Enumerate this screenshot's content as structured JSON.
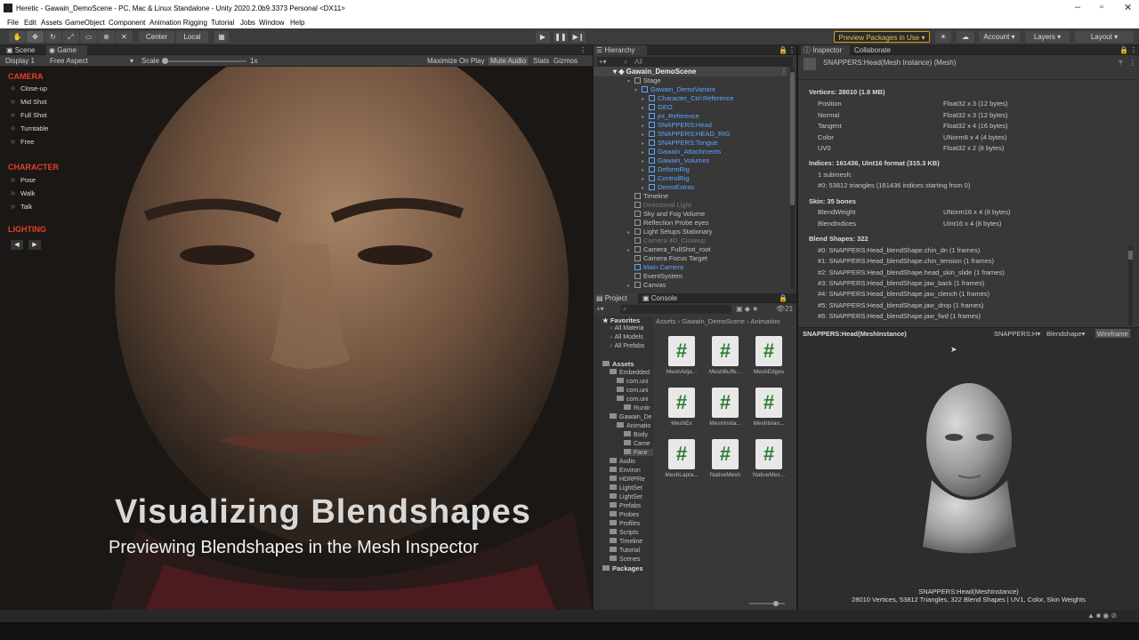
{
  "window": {
    "title": "Heretic - Gawain_DemoScene - PC, Mac & Linux Standalone - Unity 2020.2.0b9.3373 Personal <DX11>"
  },
  "menu": [
    "File",
    "Edit",
    "Assets",
    "GameObject",
    "Component",
    "Animation Rigging",
    "Tutorial",
    "Jobs",
    "Window",
    "Help"
  ],
  "toolbar": {
    "center": "Center",
    "local": "Local",
    "packages": "Preview Packages in Use",
    "account": "Account",
    "layers": "Layers",
    "layout": "Layout"
  },
  "scene_tabs": {
    "scene": "Scene",
    "game": "Game"
  },
  "game_bar": {
    "display": "Display 1",
    "aspect": "Free Aspect",
    "scale_label": "Scale",
    "scale_value": "1x",
    "maximize": "Maximize On Play",
    "mute": "Mute Audio",
    "stats": "Stats",
    "gizmos": "Gizmos"
  },
  "overlay": {
    "camera_title": "CAMERA",
    "camera_opts": [
      "Close-up",
      "Mid Shot",
      "Full Shot",
      "Turntable",
      "Free"
    ],
    "character_title": "CHARACTER",
    "character_opts": [
      "Pose",
      "Walk",
      "Talk"
    ],
    "lighting_title": "LIGHTING",
    "prev": "◀",
    "next": "▶",
    "title": "Visualizing Blendshapes",
    "subtitle": "Previewing Blendshapes in the Mesh Inspector"
  },
  "hierarchy": {
    "tab": "Hierarchy",
    "search": "All",
    "scene": "Gawain_DemoScene",
    "items": [
      {
        "label": "Stage",
        "kind": "normal"
      },
      {
        "label": "Gawain_DemoVariant",
        "kind": "blue"
      },
      {
        "label": "Character_Ctrl:Reference",
        "kind": "blue"
      },
      {
        "label": "GEO",
        "kind": "blue"
      },
      {
        "label": "jnt_Reference",
        "kind": "blue"
      },
      {
        "label": "SNAPPERS:Head",
        "kind": "blue"
      },
      {
        "label": "SNAPPERS:HEAD_RIG",
        "kind": "blue"
      },
      {
        "label": "SNAPPERS:Tongue",
        "kind": "blue"
      },
      {
        "label": "Gawain_Attachments",
        "kind": "blue"
      },
      {
        "label": "Gawain_Volumes",
        "kind": "blue"
      },
      {
        "label": "DeformRig",
        "kind": "blue"
      },
      {
        "label": "ControlRig",
        "kind": "blue"
      },
      {
        "label": "DemoExtras",
        "kind": "blue"
      },
      {
        "label": "Timeline",
        "kind": "normal"
      },
      {
        "label": "Directional Light",
        "kind": "gray"
      },
      {
        "label": "Sky and Fog Volume",
        "kind": "normal"
      },
      {
        "label": "Reflection Probe eyes",
        "kind": "normal"
      },
      {
        "label": "Light Setups Stationary",
        "kind": "normal"
      },
      {
        "label": "Camera 4D_Closeup",
        "kind": "gray"
      },
      {
        "label": "Camera_FullShot_root",
        "kind": "normal"
      },
      {
        "label": "Camera Focus Target",
        "kind": "normal"
      },
      {
        "label": "Main Camera",
        "kind": "blue"
      },
      {
        "label": "EventSystem",
        "kind": "normal"
      },
      {
        "label": "Canvas",
        "kind": "normal"
      }
    ]
  },
  "project": {
    "tab_project": "Project",
    "tab_console": "Console",
    "count": "21",
    "breadcrumb": [
      "Assets",
      "Gawain_DemoScene",
      "Animation"
    ],
    "favorites": "Favorites",
    "fav_items": [
      "All Materia",
      "All Models",
      "All Prefabs"
    ],
    "assets_label": "Assets",
    "tree": [
      "Embedded",
      "com.uni",
      "com.uni",
      "com.uni",
      "Runtir",
      "Gawain_De",
      "Animatio",
      "Body",
      "Came",
      "Face",
      "Audio",
      "Environ",
      "HDRPRe",
      "LightSet",
      "LightSet",
      "Prefabs",
      "Probes",
      "Profiles",
      "Scripts",
      "Timeline",
      "Tutorial",
      "Scenes"
    ],
    "packages": "Packages",
    "files": [
      "MeshAdja...",
      "MeshBuffe...",
      "MeshEdges",
      "MeshEx",
      "MeshInsta...",
      "MeshIslan...",
      "MeshLapla...",
      "NativeMesh",
      "NativeMes..."
    ]
  },
  "inspector": {
    "tab": "Inspector",
    "tab2": "Collaborate",
    "object": "SNAPPERS:Head(Mesh Instance) (Mesh)",
    "vertices": "Vertices: 28010 (1.8 MB)",
    "attrs": [
      [
        "Position",
        "Float32 x 3 (12 bytes)"
      ],
      [
        "Normal",
        "Float32 x 3 (12 bytes)"
      ],
      [
        "Tangent",
        "Float32 x 4 (16 bytes)"
      ],
      [
        "Color",
        "UNorm8 x 4 (4 bytes)"
      ],
      [
        "UV0",
        "Float32 x 2 (8 bytes)"
      ]
    ],
    "indices": "Indices: 161436, Uint16 format (315.3 KB)",
    "submesh": "1 submesh:",
    "submesh0": "#0: 53812 triangles (161436 indices starting from 0)",
    "skin": "Skin: 35 bones",
    "skin_attrs": [
      [
        "BlendWeight",
        "UNorm16 x 4 (8 bytes)"
      ],
      [
        "BlendIndices",
        "UInt16 x 4 (8 bytes)"
      ]
    ],
    "blend_title": "Blend Shapes: 322",
    "blends": [
      "#0: SNAPPERS:Head_blendShape.chin_dn (1 frames)",
      "#1: SNAPPERS:Head_blendShape.chin_tension (1 frames)",
      "#2: SNAPPERS:Head_blendShape.head_skin_slide (1 frames)",
      "#3: SNAPPERS:Head_blendShape.jaw_back (1 frames)",
      "#4: SNAPPERS:Head_blendShape.jaw_clench (1 frames)",
      "#5: SNAPPERS:Head_blendShape.jaw_drop (1 frames)",
      "#6: SNAPPERS:Head_blendShape.jaw_fwd (1 frames)"
    ],
    "preview_name": "SNAPPERS:Head(MeshInstance)",
    "preview_dd1": "SNAPPERS:H",
    "preview_dd2": "Blendshape",
    "preview_wire": "Wireframe",
    "caption1": "SNAPPERS:Head(MeshInstance)",
    "caption2": "28010 Vertices, 53812 Triangles, 322 Blend Shapes | UV1, Color, Skin Weights"
  },
  "colors": {
    "accent": "#e0402c",
    "blue": "#5ba6ff"
  }
}
